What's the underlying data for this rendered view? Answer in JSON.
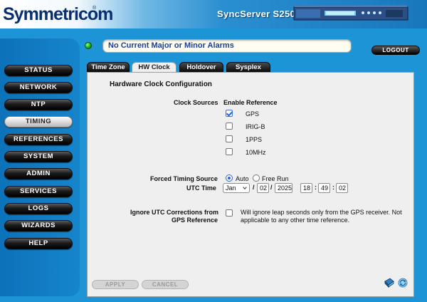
{
  "header": {
    "brand": "Symmetricom",
    "brand_mark": "®",
    "product": "SyncServer S250"
  },
  "sidebar": {
    "items": [
      {
        "label": "STATUS"
      },
      {
        "label": "NETWORK"
      },
      {
        "label": "NTP"
      },
      {
        "label": "TIMING",
        "active": true
      },
      {
        "label": "REFERENCES"
      },
      {
        "label": "SYSTEM"
      },
      {
        "label": "ADMIN"
      },
      {
        "label": "SERVICES"
      },
      {
        "label": "LOGS"
      },
      {
        "label": "WIZARDS"
      },
      {
        "label": "HELP"
      }
    ]
  },
  "alarm": {
    "text": "No Current Major or Minor Alarms",
    "led_color": "#11a611"
  },
  "logout_label": "LOGOUT",
  "tabs": [
    {
      "label": "Time Zone"
    },
    {
      "label": "HW Clock",
      "active": true
    },
    {
      "label": "Holdover"
    },
    {
      "label": "Sysplex"
    }
  ],
  "content": {
    "title": "Hardware Clock Configuration",
    "clock_sources_label": "Clock Sources",
    "enable_reference_label": "Enable Reference",
    "sources": [
      {
        "name": "GPS",
        "checked": true
      },
      {
        "name": "IRIG-B",
        "checked": false
      },
      {
        "name": "1PPS",
        "checked": false
      },
      {
        "name": "10MHz",
        "checked": false
      }
    ],
    "forced_timing_label": "Forced Timing Source",
    "radio_auto": "Auto",
    "radio_free_run": "Free Run",
    "selected_timing": "Auto",
    "utc_time_label": "UTC Time",
    "utc": {
      "month": "Jan",
      "day": "02",
      "year": "2025",
      "hour": "18",
      "minute": "49",
      "second": "02",
      "date_sep": "/",
      "time_sep": ":"
    },
    "ignore_utc_label_1": "Ignore UTC Corrections from",
    "ignore_utc_label_2": "GPS Reference",
    "ignore_utc_checked": false,
    "ignore_utc_desc_1": "Will ignore leap seconds only from the GPS receiver. Not",
    "ignore_utc_desc_2": "applicable to any other time reference."
  },
  "footer": {
    "apply_label": "APPLY",
    "cancel_label": "CANCEL",
    "icons": [
      "help-book-icon",
      "refresh-icon"
    ]
  },
  "colors": {
    "accent_blue": "#1c94d6",
    "brand_navy": "#0a2f6e",
    "alarm_text": "#1c3f93"
  }
}
